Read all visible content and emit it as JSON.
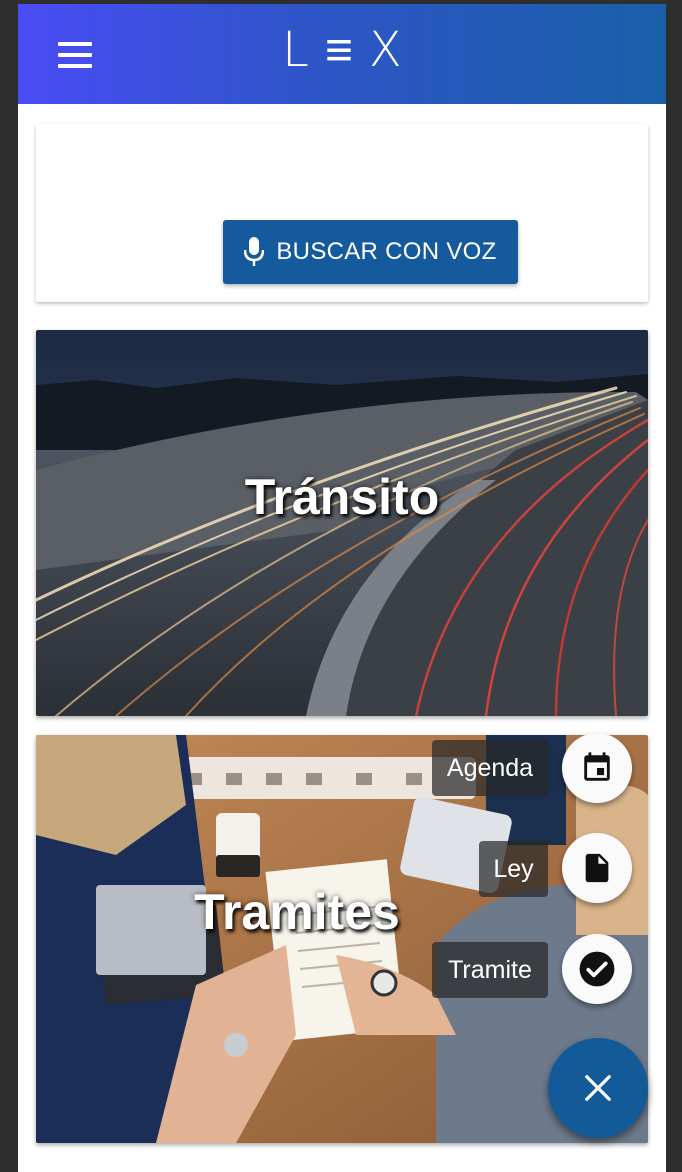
{
  "header": {
    "logo": "L≡X",
    "menu_icon": "hamburger-menu-icon"
  },
  "voice_search": {
    "button_label": "BUSCAR CON VOZ",
    "icon": "microphone-icon"
  },
  "categories": [
    {
      "title": "Tránsito"
    },
    {
      "title": "Tramites"
    }
  ],
  "speed_dial": {
    "items": [
      {
        "label": "Agenda",
        "icon": "calendar-icon"
      },
      {
        "label": "Ley",
        "icon": "document-icon"
      },
      {
        "label": "Tramite",
        "icon": "check-circle-icon"
      }
    ],
    "close_icon": "close-icon"
  },
  "colors": {
    "header_start": "#4a4cf5",
    "header_end": "#1a60a8",
    "primary": "#155a9c"
  }
}
